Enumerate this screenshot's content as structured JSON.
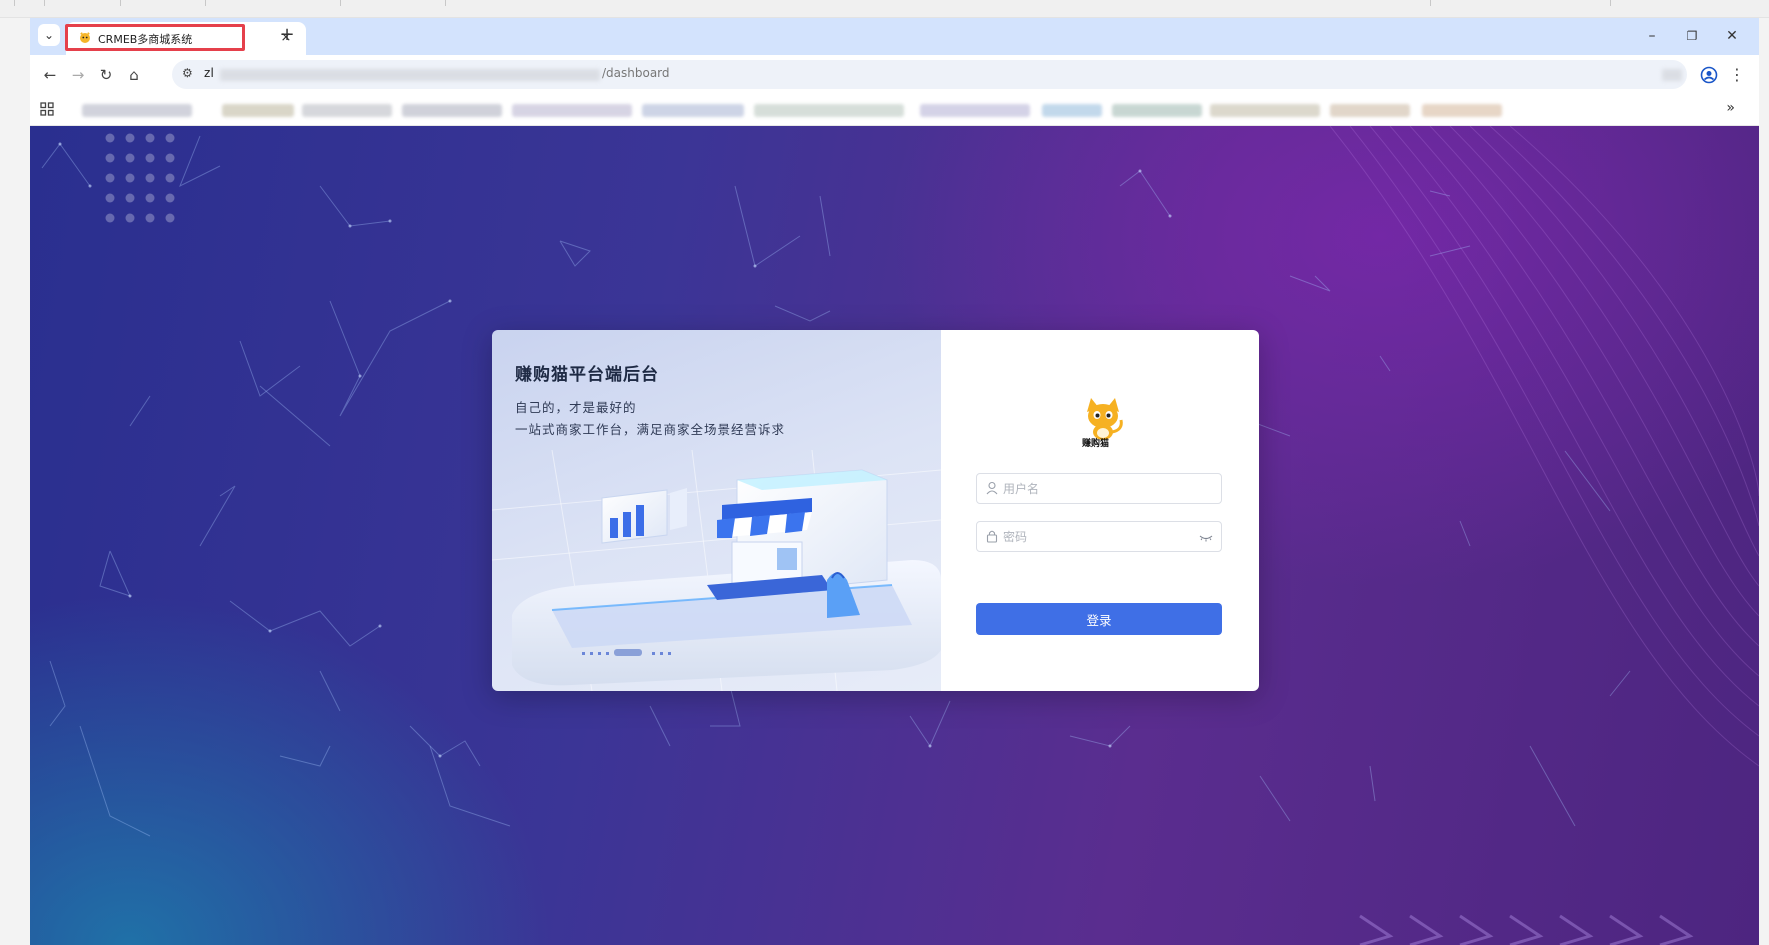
{
  "browser": {
    "tab": {
      "title": "CRMEB多商城系统",
      "favicon": "cat-logo-icon",
      "close": "×"
    },
    "new_tab": "+",
    "window_controls": {
      "minimize": "–",
      "restore": "❐",
      "close": "✕"
    },
    "nav": {
      "back": "←",
      "forward": "→",
      "reload": "↻",
      "home": "⌂"
    },
    "omnibox": {
      "url_start": "zl",
      "url_end": "/dashboard"
    },
    "bookmarks_more": "»"
  },
  "login": {
    "title": "赚购猫平台端后台",
    "subtitle1": "自己的，才是最好的",
    "subtitle2": "一站式商家工作台，满足商家全场景经营诉求",
    "logo_caption": "赚购猫",
    "username_placeholder": "用户名",
    "password_placeholder": "密码",
    "submit_label": "登录"
  },
  "colors": {
    "accent": "#3f6fe6",
    "tab_highlight": "#e5404b",
    "tabbar_bg": "#d3e3fd"
  }
}
